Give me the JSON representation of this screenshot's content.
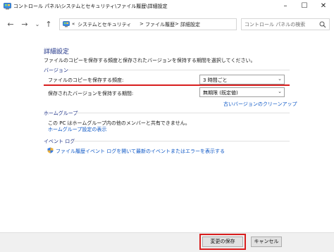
{
  "window": {
    "title": "コントロール パネル\\システムとセキュリティ\\ファイル履歴\\詳細設定",
    "minimize_glyph": "–",
    "maximize_glyph": "☐",
    "close_glyph": "✕"
  },
  "nav": {
    "back_glyph": "←",
    "forward_glyph": "→",
    "history_glyph": "⌄",
    "up_glyph": "↑"
  },
  "address": {
    "overflow": "«",
    "crumbs": [
      "システムとセキュリティ",
      "ファイル履歴",
      "詳細設定"
    ],
    "separator": ">",
    "dropdown_glyph": "⌄",
    "refresh_glyph": "↻"
  },
  "search": {
    "placeholder": "コントロール パネルの検索"
  },
  "main": {
    "heading": "詳細設定",
    "description": "ファイルのコピーを保存する頻度と保存されたバージョンを保持する期間を選択してください。",
    "versions": {
      "title": "バージョン",
      "frequency_label": "ファイルのコピーを保存する頻度:",
      "frequency_value": "3 時間ごと",
      "retention_label": "保存されたバージョンを保持する期間:",
      "retention_value": "無期限 (既定値)",
      "cleanup_link": "古いバージョンのクリーンアップ"
    },
    "homegroup": {
      "title": "ホームグループ",
      "text": "この PC はホームグループ内の他のメンバーと共有できません。",
      "link": "ホームグループ設定の表示"
    },
    "eventlog": {
      "title": "イベント ログ",
      "link": "ファイル履歴イベント ログを開いて最新のイベントまたはエラーを表示する"
    }
  },
  "footer": {
    "save_label": "変更の保存",
    "cancel_label": "キャンセル"
  },
  "colors": {
    "accent_heading": "#1e3287",
    "link": "#0b56c6",
    "highlight": "#d81e1e"
  }
}
